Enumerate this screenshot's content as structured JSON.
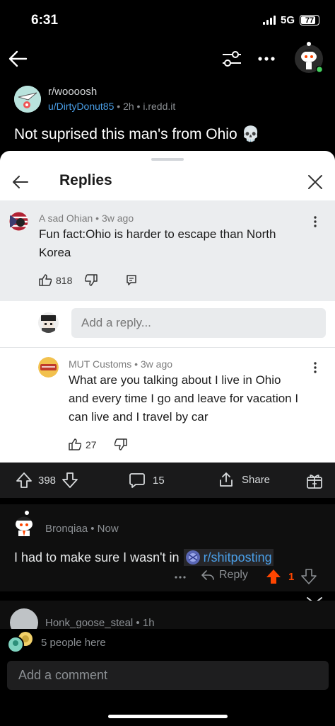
{
  "status": {
    "time": "6:31",
    "network": "5G",
    "battery": "77"
  },
  "post": {
    "subreddit": "r/woooosh",
    "user": "u/DirtyDonut85",
    "age": "2h",
    "domain": "i.redd.it",
    "title": "Not suprised this man's from Ohio 💀"
  },
  "replies_sheet": {
    "title": "Replies",
    "focus_comment": {
      "author": "A sad Ohian",
      "age": "3w ago",
      "text_line1": "Fun fact:Ohio is harder to escape than North",
      "text_line2": "Korea",
      "upvotes": "818"
    },
    "reply_placeholder": "Add a reply...",
    "child_comment": {
      "author": "MUT Customs",
      "age": "3w ago",
      "text_line1": "What are you talking about I live in Ohio",
      "text_line2": "and every time I go and leave for vacation I",
      "text_line3": "can live and I travel by car",
      "upvotes": "27"
    }
  },
  "action_bar": {
    "votes": "398",
    "comments": "15",
    "share": "Share"
  },
  "comment": {
    "author": "Bronqiaa",
    "age": "Now",
    "text": "I had to make sure I wasn't in",
    "link": "r/shitposting",
    "reply_label": "Reply",
    "votes": "1"
  },
  "next_comment": {
    "author": "Honk_goose_steal",
    "age": "1h"
  },
  "bottom": {
    "people_here": "5 people here",
    "comment_placeholder": "Add a comment"
  },
  "colors": {
    "accent_blue": "#4a9fe8",
    "upvote_orange": "#ff4500",
    "link_blue": "#4a9fe8"
  }
}
